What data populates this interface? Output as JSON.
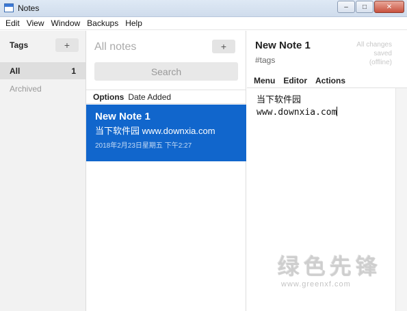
{
  "window": {
    "title": "Notes",
    "minimize": "‒",
    "maximize": "□",
    "close": "✕"
  },
  "menu": [
    "Edit",
    "View",
    "Window",
    "Backups",
    "Help"
  ],
  "tags": {
    "title": "Tags",
    "add": "+",
    "items": [
      {
        "label": "All",
        "count": "1"
      },
      {
        "label": "Archived"
      }
    ]
  },
  "list": {
    "header": "All notes",
    "add": "+",
    "search_placeholder": "Search",
    "options_label": "Options",
    "sort_label": "Date Added",
    "notes": [
      {
        "title": "New Note 1",
        "preview": "当下软件园 www.downxia.com",
        "date": "2018年2月23日星期五 下午2:27"
      }
    ]
  },
  "editor": {
    "title": "New Note 1",
    "tags_placeholder": "#tags",
    "status": "All changes saved (offline)",
    "toolbar": [
      "Menu",
      "Editor",
      "Actions"
    ],
    "lines": [
      "当下软件园",
      "www.downxia.com"
    ]
  },
  "watermark": {
    "big": "绿色先锋",
    "small": "www.greenxf.com"
  }
}
